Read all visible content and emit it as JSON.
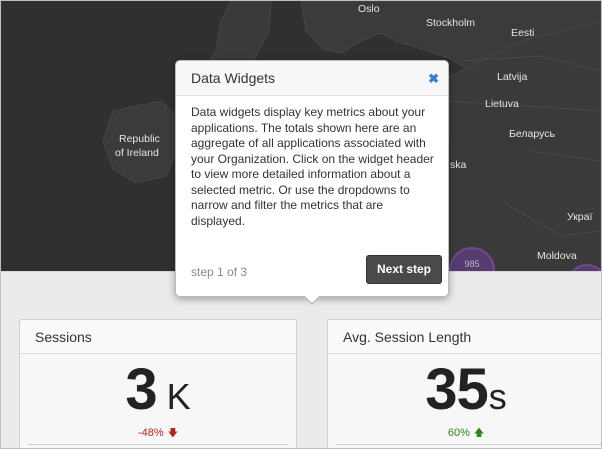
{
  "map": {
    "labels": {
      "oslo": "Oslo",
      "stockholm": "Stockholm",
      "eesti": "Eesti",
      "latvija": "Latvija",
      "lietuva": "Lietuva",
      "ireland1": "Republic",
      "ireland2": "of Ireland",
      "belarus": "Беларусь",
      "polska_fragment": "ska",
      "ukraine": "Украї",
      "moldova": "Moldova"
    },
    "dot_count": "985"
  },
  "popover": {
    "title": "Data Widgets",
    "close_icon": "✖",
    "body": "Data widgets display key metrics about your applications. The totals shown here are an aggregate of all applications associated with your Organization. Click on the widget header to view more detailed information about a selected metric. Or use the dropdowns to narrow and filter the metrics that are displayed.",
    "step": "step 1 of 3",
    "next_button": "Next step"
  },
  "widgets": [
    {
      "title": "Sessions",
      "value": "3",
      "unit": "K",
      "delta": "-48%",
      "delta_direction": "down",
      "delta_color": "#b8231b"
    },
    {
      "title": "Avg. Session Length",
      "value": "35",
      "unit": "s",
      "delta": "60%",
      "delta_direction": "up",
      "delta_color": "#2e8a14"
    }
  ]
}
